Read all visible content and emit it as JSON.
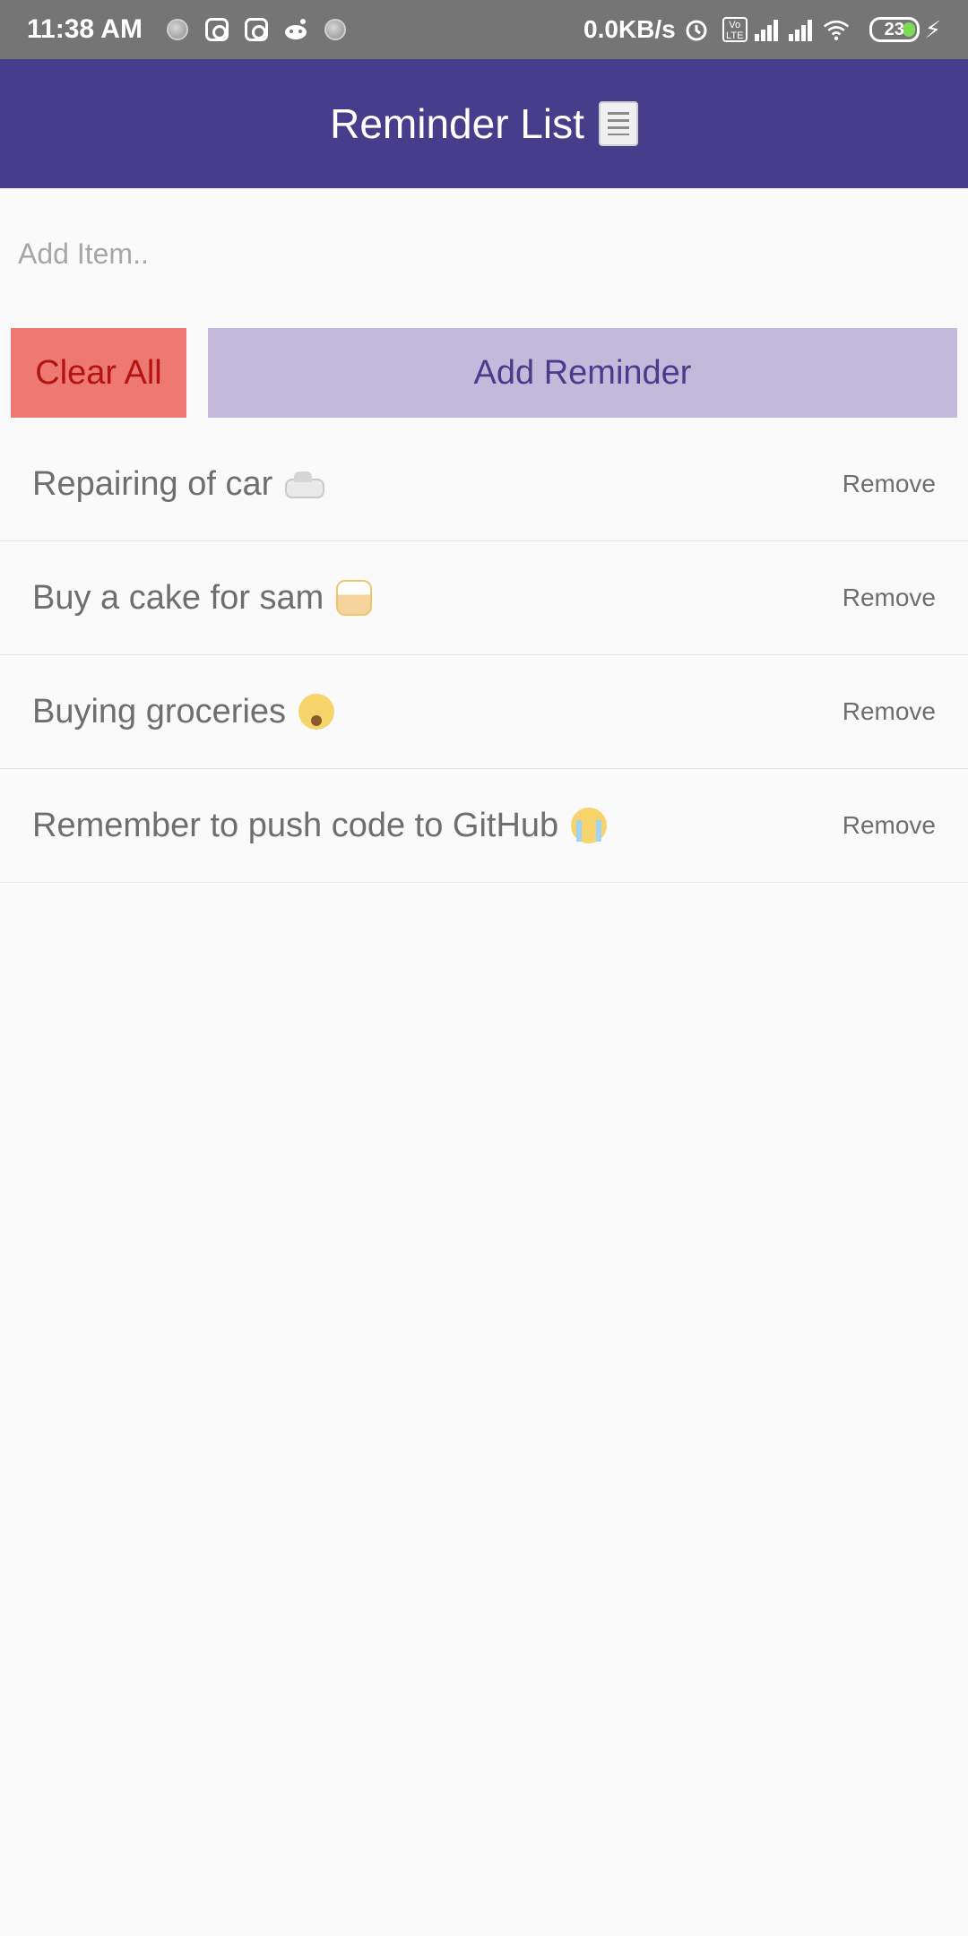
{
  "status_bar": {
    "time": "11:38 AM",
    "net_speed": "0.0KB/s",
    "lte": "Vo LTE",
    "battery": "23"
  },
  "app_bar": {
    "title": "Reminder List",
    "title_icon": "scroll-icon"
  },
  "input": {
    "value": "",
    "placeholder": "Add Item.."
  },
  "buttons": {
    "clear_all": "Clear All",
    "add_reminder": "Add Reminder"
  },
  "reminders": [
    {
      "text": "Repairing of car",
      "emoji": "car-emoji",
      "action": "Remove"
    },
    {
      "text": "Buy a cake for sam",
      "emoji": "cake-emoji",
      "action": "Remove"
    },
    {
      "text": "Buying groceries",
      "emoji": "drooling-face-emoji",
      "action": "Remove"
    },
    {
      "text": "Remember to push code to GitHub",
      "emoji": "crying-face-emoji",
      "action": "Remove"
    }
  ],
  "colors": {
    "status_bar": "#757575",
    "app_bar": "#483d8b",
    "clear_button": "#ee7872",
    "clear_text": "#b3140f",
    "add_button": "#c3b9da",
    "add_text": "#483d8b",
    "background": "#fafafa"
  }
}
